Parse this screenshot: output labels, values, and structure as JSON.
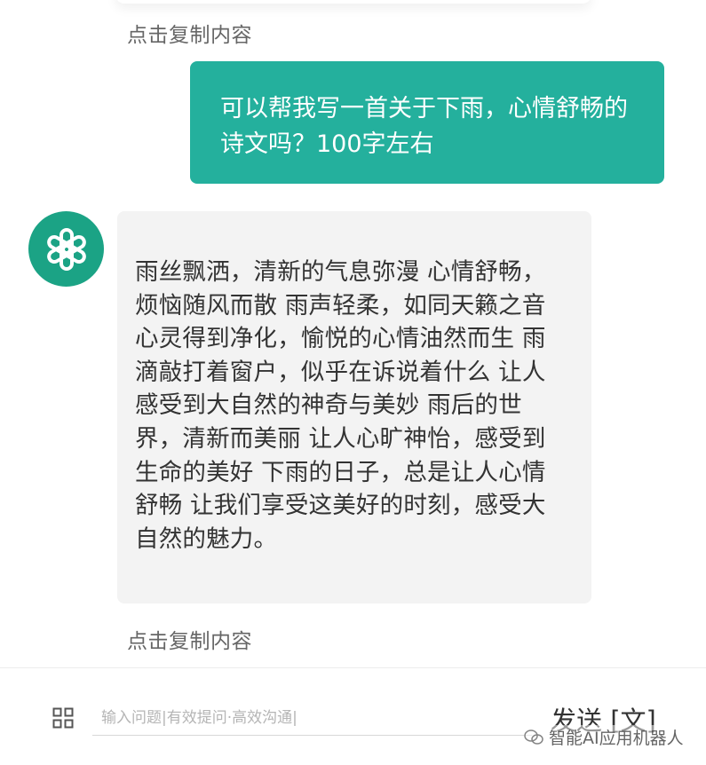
{
  "chat": {
    "copy_label_top": "点击复制内容",
    "copy_label_bottom": "点击复制内容",
    "user_message": "可以帮我写一首关于下雨，心情舒畅的诗文吗？100字左右",
    "bot_message": "雨丝飘洒，清新的气息弥漫 心情舒畅，烦恼随风而散 雨声轻柔，如同天籁之音 心灵得到净化，愉悦的心情油然而生 雨滴敲打着窗户，似乎在诉说着什么 让人感受到大自然的神奇与美妙 雨后的世界，清新而美丽 让人心旷神怡，感受到生命的美好 下雨的日子，总是让人心情舒畅 让我们享受这美好的时刻，感受大自然的魅力。",
    "avatar_icon": "openai-logo-icon"
  },
  "input_bar": {
    "menu_icon": "grid-icon",
    "placeholder": "输入问题|有效提问·高效沟通|",
    "send_label": "发送 [文]"
  },
  "watermark": {
    "text": "智能AI应用机器人",
    "icon": "wechat-icon"
  },
  "colors": {
    "user_bubble": "#24b09d",
    "bot_bubble": "#f3f3f3",
    "avatar": "#1ba385"
  }
}
